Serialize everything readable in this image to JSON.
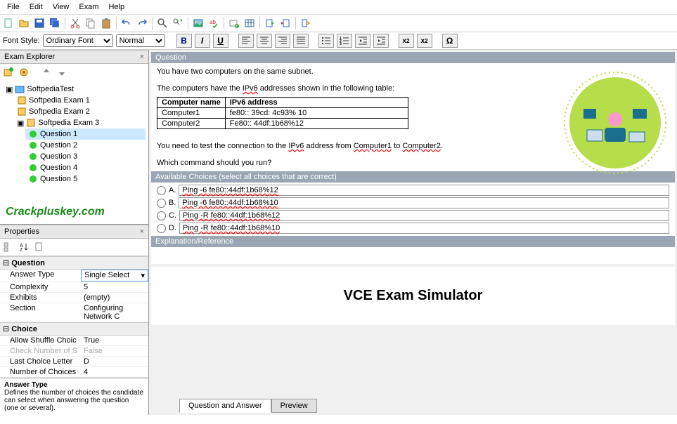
{
  "menu": {
    "file": "File",
    "edit": "Edit",
    "view": "View",
    "exam": "Exam",
    "help": "Help"
  },
  "fontbar": {
    "label": "Font Style:",
    "font": "Ordinary Font",
    "size": "Normal"
  },
  "explorer": {
    "title": "Exam Explorer",
    "root": "SoftpediaTest",
    "exams": [
      "Softpedia Exam 1",
      "Softpedia Exam 2",
      "Softpedia Exam 3"
    ],
    "questions": [
      "Question 1",
      "Question 2",
      "Question 3",
      "Question 4",
      "Question 5"
    ]
  },
  "watermark": "Crackpluskey.com",
  "properties": {
    "title": "Properties",
    "sections": {
      "question": {
        "label": "Question",
        "rows": [
          {
            "name": "Answer Type",
            "value": "Single Select"
          },
          {
            "name": "Complexity",
            "value": "5"
          },
          {
            "name": "Exhibits",
            "value": "(empty)"
          },
          {
            "name": "Section",
            "value": "Configuring Network C"
          }
        ]
      },
      "choice": {
        "label": "Choice",
        "rows": [
          {
            "name": "Allow Shuffle Choic",
            "value": "True"
          },
          {
            "name": "Check Number of S",
            "value": "False",
            "disabled": true
          },
          {
            "name": "Last Choice Letter",
            "value": "D"
          },
          {
            "name": "Number of Choices",
            "value": "4"
          }
        ]
      }
    },
    "help": {
      "title": "Answer Type",
      "text": "Defines the number of choices the candidate can select when answering the question (one or several)."
    }
  },
  "question": {
    "hdr": "Question",
    "line1": "You have two computers on the same subnet.",
    "line2_a": "The computers have the ",
    "line2_b": "IPv6",
    "line2_c": " addresses shown in the following table:",
    "table": {
      "h1": "Computer name",
      "h2": "IPv6 address",
      "r1c1": "Computer1",
      "r1c2": "fe80:: 39cd: 4c93% 10",
      "r2c1": "Computer2",
      "r2c2": "Fe80:: 44df:1b68%12"
    },
    "line3_a": "You need to test the connection to the ",
    "line3_b": "IPv6",
    "line3_c": " address from ",
    "line3_d": "Computer1",
    "line3_e": " to ",
    "line3_f": "Computer2",
    "line3_g": ".",
    "line4": "Which command should you run?"
  },
  "choices": {
    "hdr": "Available Choices (select all choices that are correct)",
    "items": [
      {
        "letter": "A.",
        "text": "Ping -6 fe80::44df:1b68%12"
      },
      {
        "letter": "B.",
        "text": "Ping -6 fe80::44df:1b68%10"
      },
      {
        "letter": "C.",
        "text": "Ping -R fe80::44df:1b68%12"
      },
      {
        "letter": "D.",
        "text": "Ping -R fe80::44df:1b68%10"
      }
    ]
  },
  "explanation": {
    "hdr": "Explanation/Reference"
  },
  "brand": "VCE Exam Simulator",
  "tabs": {
    "qa": "Question and Answer",
    "preview": "Preview"
  }
}
